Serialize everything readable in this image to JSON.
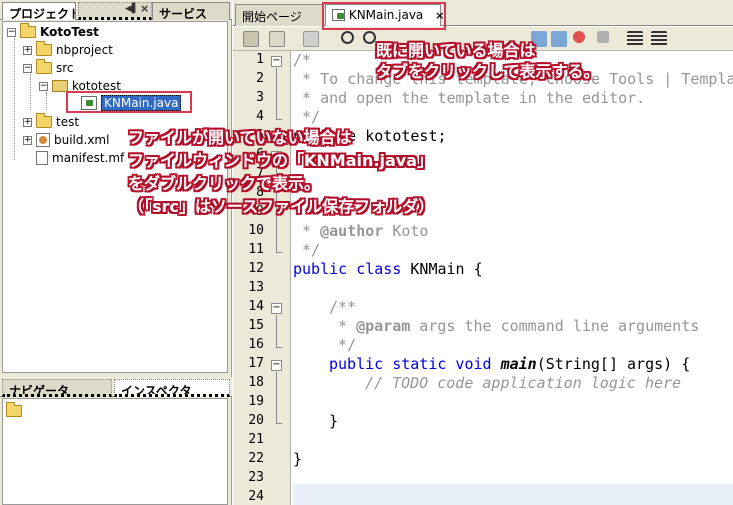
{
  "project_panel": {
    "tabs": [
      "プロジェクト",
      "サービス"
    ],
    "tree": {
      "root": "KotoTest",
      "nbproject": "nbproject",
      "src": "src",
      "package": "kototest",
      "file_selected": "KNMain.java",
      "test": "test",
      "build": "build.xml",
      "manifest": "manifest.mf"
    }
  },
  "navigator_panel": {
    "tabs": [
      "ナビゲータ",
      "インスペクタ"
    ]
  },
  "editor": {
    "tabs": [
      "開始ページ",
      "KNMain.java"
    ],
    "active_tab": "KNMain.java",
    "line_numbers": [
      "1",
      "2",
      "3",
      "4",
      "5",
      "6",
      "7",
      "8",
      "9",
      "10",
      "11",
      "12",
      "13",
      "14",
      "15",
      "16",
      "17",
      "18",
      "19",
      "20",
      "21",
      "22",
      "23",
      "24"
    ],
    "code": {
      "l1": "/*",
      "l2": " * To change this template, choose Tools | Templa",
      "l3": " * and open the template in the editor.",
      "l4": " */",
      "l5": "package kototest;",
      "l10_a": " * ",
      "l10_tag": "@author",
      "l10_b": " Koto",
      "l11": " */",
      "l12_kw": "public class",
      "l12_name": " KNMain {",
      "l14": "/**",
      "l15_a": " * ",
      "l15_tag": "@param",
      "l15_b": " args the command line arguments",
      "l16": " */",
      "l17_kw": "public static void",
      "l17_m": "main",
      "l17_rest": "(String[] args) {",
      "l18": "// TODO code application logic here",
      "l20": "}",
      "l22": "}"
    }
  },
  "annotations": {
    "tab_note": "既に開いている場合は\nタブをクリックして表示する。",
    "file_note": "ファイルが開いていない場合は\nファイルウィンドウの「KNMain.java」\nをダブルクリックで表示。\n（「src」はソースファイル保存フォルダ）"
  },
  "colors": {
    "annotation_outline": "#b2102a",
    "highlight_box": "#d93a50",
    "selection": "#316ac5",
    "keyword": "#0000e6",
    "comment": "#969696"
  }
}
